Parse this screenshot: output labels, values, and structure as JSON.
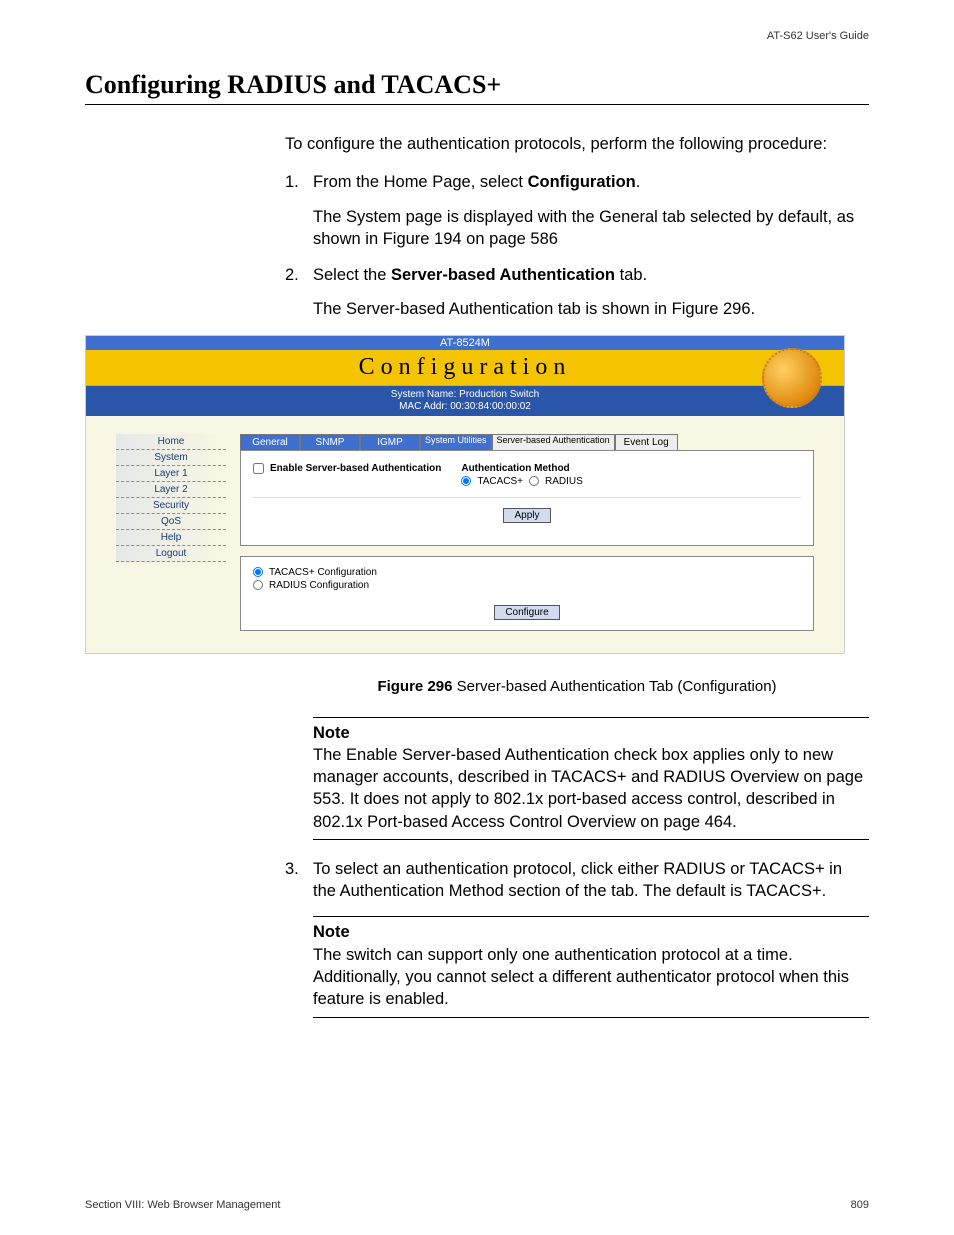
{
  "header": {
    "guide": "AT-S62 User's Guide"
  },
  "title": "Configuring RADIUS and TACACS+",
  "intro": "To configure the authentication protocols, perform the following procedure:",
  "steps": [
    {
      "num": "1.",
      "text_a": "From the Home Page, select ",
      "bold_a": "Configuration",
      "text_b": ".",
      "sub": "The System page is displayed with the General tab selected by default, as shown in Figure 194 on page 586"
    },
    {
      "num": "2.",
      "text_a": "Select the ",
      "bold_a": "Server-based Authentication",
      "text_b": " tab.",
      "sub": "The Server-based Authentication tab is shown in Figure 296."
    }
  ],
  "figure": {
    "device": "AT-8524M",
    "banner": "Configuration",
    "sysname": "System Name: Production Switch",
    "mac": "MAC Addr: 00:30:84:00:00:02",
    "sidebar": [
      "Home",
      "System",
      "Layer 1",
      "Layer 2",
      "Security",
      "QoS",
      "Help",
      "Logout"
    ],
    "tabs": {
      "general": "General",
      "snmp": "SNMP",
      "igmp": "IGMP",
      "sysutil": "System Utilities",
      "sba": "Server-based Authentication",
      "eventlog": "Event Log"
    },
    "panel": {
      "enable_label": "Enable Server-based Authentication",
      "authmethod_label": "Authentication Method",
      "tacacs": "TACACS+",
      "radius": "RADIUS",
      "apply_btn": "Apply"
    },
    "panel2": {
      "tacacs_cfg": "TACACS+ Configuration",
      "radius_cfg": "RADIUS Configuration",
      "configure_btn": "Configure"
    }
  },
  "caption": {
    "label": "Figure 296",
    "text": "  Server-based Authentication Tab (Configuration)"
  },
  "note1": {
    "title": "Note",
    "body": "The Enable Server-based Authentication check box applies only to new manager accounts, described in TACACS+ and RADIUS Overview on page 553. It does not apply to 802.1x port-based access control, described in 802.1x Port-based Access Control Overview on page 464."
  },
  "step3": {
    "num": "3.",
    "text": "To select an authentication protocol, click either RADIUS or TACACS+ in the Authentication Method section of the tab. The default is TACACS+."
  },
  "note2": {
    "title": "Note",
    "body": "The switch can support only one authentication protocol at a time. Additionally, you cannot select a different authenticator protocol when this feature is enabled."
  },
  "footer": {
    "section": "Section VIII: Web Browser Management",
    "page": "809"
  }
}
